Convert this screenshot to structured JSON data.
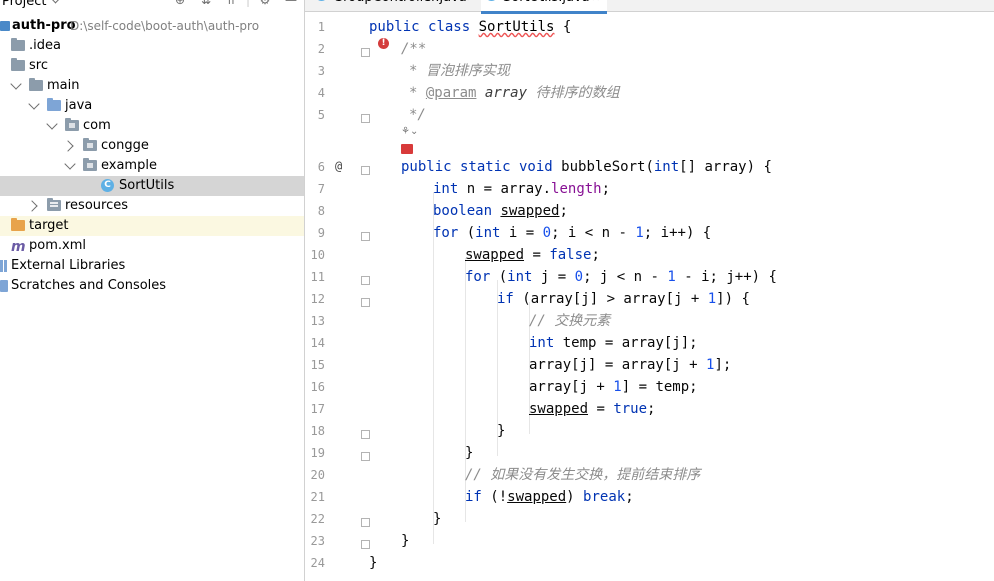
{
  "project_panel": {
    "title": "Project",
    "tree": [
      {
        "label": "auth-pro",
        "path": "D:\\self-code\\boot-auth\\auth-pro"
      },
      {
        "label": ".idea"
      },
      {
        "label": "src"
      },
      {
        "label": "main"
      },
      {
        "label": "java"
      },
      {
        "label": "com"
      },
      {
        "label": "congge"
      },
      {
        "label": "example"
      },
      {
        "label": "SortUtils"
      },
      {
        "label": "resources"
      },
      {
        "label": "target"
      },
      {
        "label": "pom.xml"
      },
      {
        "label": "External Libraries"
      },
      {
        "label": "Scratches and Consoles"
      }
    ]
  },
  "editor": {
    "tabs": [
      {
        "label": "GroupController.java",
        "active": false
      },
      {
        "label": "SortUtils.java",
        "active": true
      }
    ],
    "line_numbers": [
      "1",
      "2",
      "3",
      "4",
      "5",
      "6",
      "7",
      "8",
      "9",
      "10",
      "11",
      "12",
      "13",
      "14",
      "15",
      "16",
      "17",
      "18",
      "19",
      "20",
      "21",
      "22",
      "23",
      "24"
    ],
    "code": {
      "l1_public": "public",
      "l1_class": "class",
      "l1_name": "SortUtils",
      "l1_brace": "{",
      "l2": "/**",
      "l3": "* 冒泡排序实现",
      "l4_star": "*",
      "l4_tag": "@param",
      "l4_param": "array",
      "l4_desc": "待排序的数组",
      "l5": "*/",
      "l6_mods": "public static void",
      "l6_rest": "bubbleSort(",
      "l6_int": "int",
      "l6_tail": "[] array) {",
      "l7_int": "int",
      "l7_mid": "n = array.",
      "l7_field": "length",
      "l7_end": ";",
      "l8_bool": "boolean",
      "l8_var": "swapped",
      "l8_end": ";",
      "l9_for": "for",
      "l9_a": "(",
      "l9_int": "int",
      "l9_b": " i = ",
      "l9_zero": "0",
      "l9_c": "; i < n - ",
      "l9_one": "1",
      "l9_d": "; i++) {",
      "l10_var": "swapped",
      "l10_eq": " = ",
      "l10_false": "false",
      "l10_end": ";",
      "l11_for": "for",
      "l11_a": "(",
      "l11_int": "int",
      "l11_b": " j = ",
      "l11_zero": "0",
      "l11_c": "; j < n - ",
      "l11_one": "1",
      "l11_d": " - i; j++) {",
      "l12_if": "if",
      "l12_a": " (array[j] > array[j + ",
      "l12_one": "1",
      "l12_b": "]) {",
      "l13": "// 交换元素",
      "l14_int": "int",
      "l14_rest": " temp = array[j];",
      "l15_a": "array[j] = array[j + ",
      "l15_one": "1",
      "l15_b": "];",
      "l16_a": "array[j + ",
      "l16_one": "1",
      "l16_b": "] = temp;",
      "l17_var": "swapped",
      "l17_eq": " = ",
      "l17_true": "true",
      "l17_end": ";",
      "l18": "}",
      "l19": "}",
      "l20": "// 如果没有发生交换，提前结束排序",
      "l21_if": "if",
      "l21_a": " (!",
      "l21_var": "swapped",
      "l21_b": ") ",
      "l21_break": "break",
      "l21_end": ";",
      "l22": "}",
      "l23": "}",
      "l24": "}"
    },
    "override_marker": "@"
  },
  "colors": {
    "keyword": "#0033b3",
    "number": "#1750eb",
    "comment": "#8c8c8c",
    "field": "#871094",
    "selection": "#d5d5d5",
    "excluded_folder_bg": "#fbf8e1",
    "active_tab_underline": "#4083c9"
  }
}
